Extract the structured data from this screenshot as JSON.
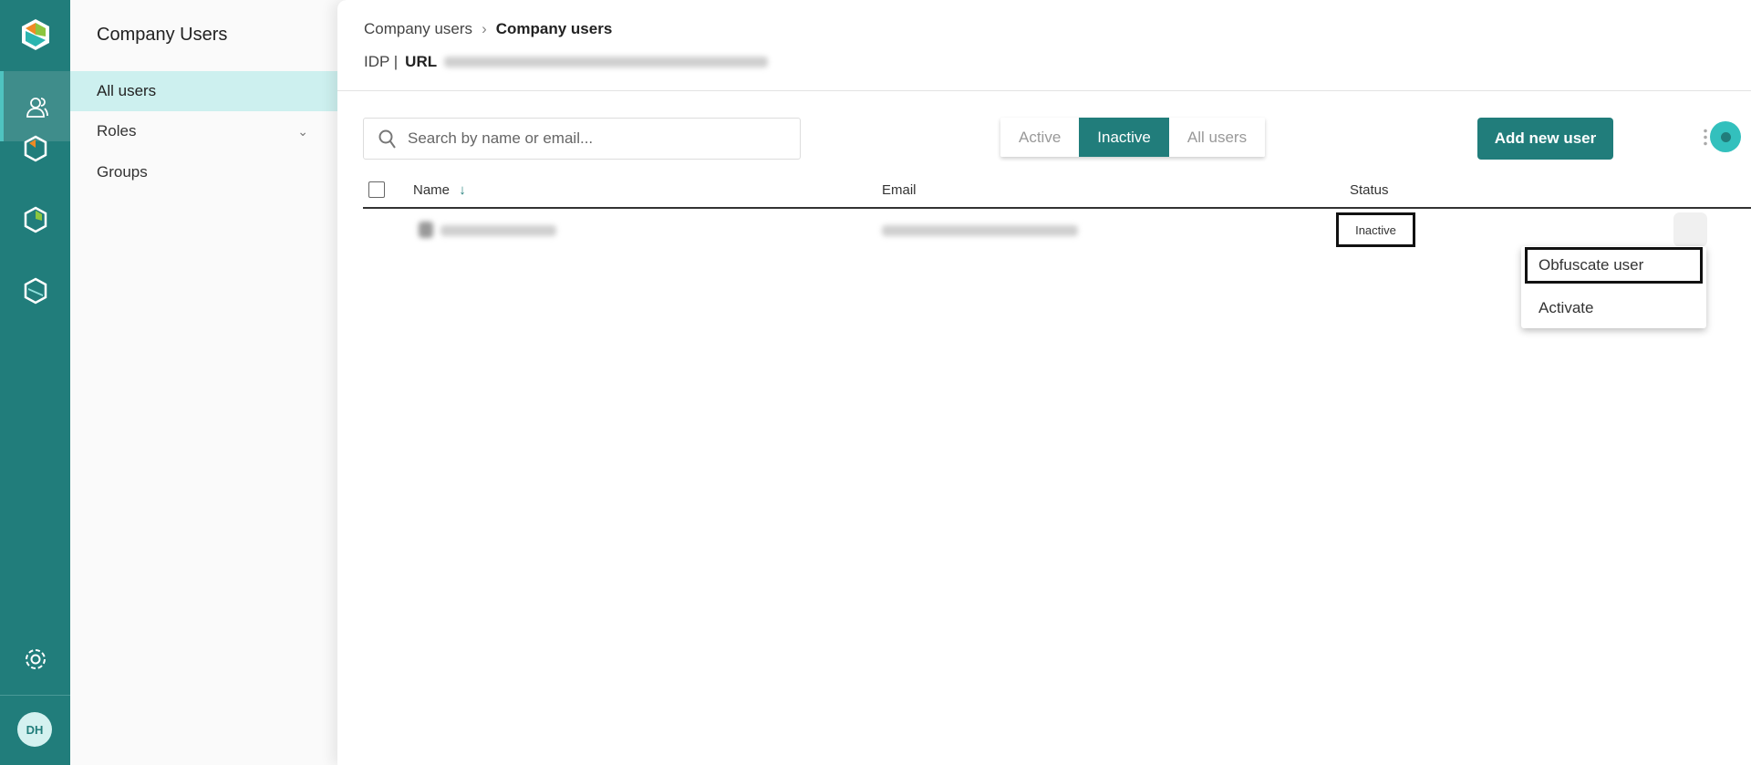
{
  "rail": {
    "items": [
      "logo-icon",
      "users-icon",
      "product-a-icon",
      "product-b-icon",
      "product-c-icon",
      "settings-icon"
    ],
    "avatar": "DH"
  },
  "sidebar": {
    "title": "Company Users",
    "items": [
      {
        "label": "All users"
      },
      {
        "label": "Roles"
      },
      {
        "label": "Groups"
      }
    ]
  },
  "header": {
    "breadcrumb": [
      "Company users",
      "Company users"
    ],
    "idp_label": "IDP |",
    "url_label": "URL"
  },
  "toolbar": {
    "search_placeholder": "Search by name or email...",
    "filters": [
      "Active",
      "Inactive",
      "All users"
    ],
    "selected_filter": "Inactive",
    "add_label": "Add new user"
  },
  "table": {
    "columns": [
      "Name",
      "Email",
      "Status"
    ],
    "rows": [
      {
        "status": "Inactive"
      }
    ]
  },
  "menu": {
    "items": [
      "Obfuscate user",
      "Activate"
    ]
  },
  "colors": {
    "brand": "#217d7b",
    "accent": "#33c0bd",
    "selected_nav": "#cdf0ef"
  }
}
